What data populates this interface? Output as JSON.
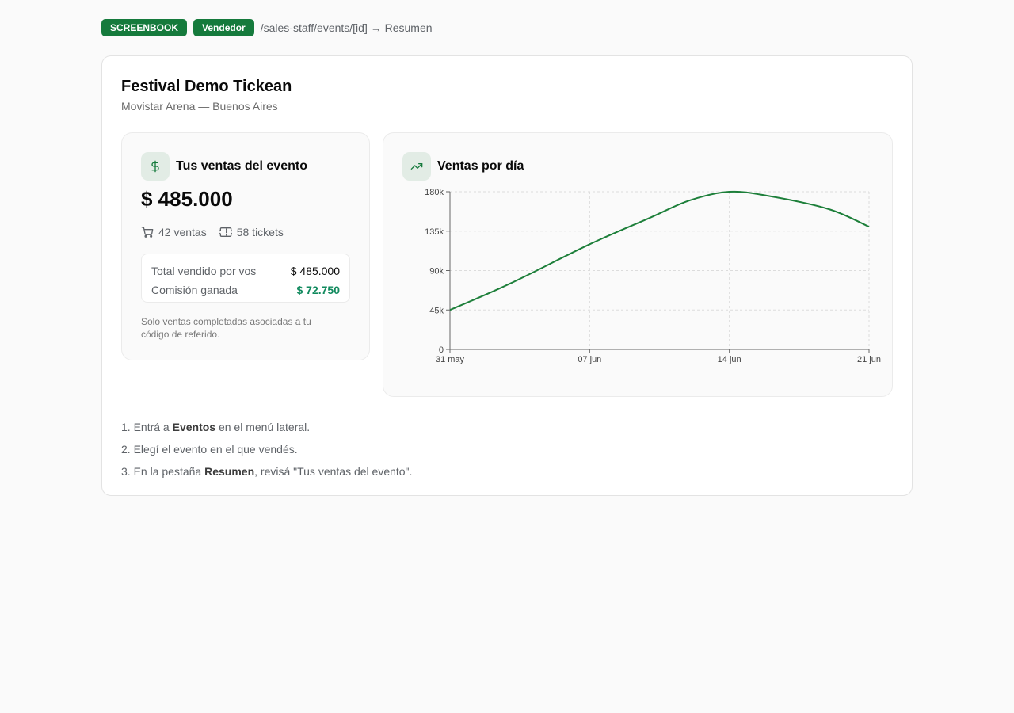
{
  "header": {
    "badge_screenbook": "SCREENBOOK",
    "badge_role": "Vendedor",
    "route": "/sales-staff/events/[id] → Resumen"
  },
  "event": {
    "title": "Festival Demo Tickean",
    "venue": "Movistar Arena — Buenos Aires"
  },
  "sales_panel": {
    "icon": "dollar-icon",
    "title": "Tus ventas del evento",
    "amount": "$ 485.000",
    "sales_count": "42 ventas",
    "tickets_count": "58 tickets",
    "total_label": "Total vendido por vos",
    "total_value": "$ 485.000",
    "commission_label": "Comisión ganada",
    "commission_value": "$ 72.750",
    "note": "Solo ventas completadas asociadas a tu código de referido."
  },
  "chart_panel": {
    "icon": "trending-up-icon",
    "title": "Ventas por día"
  },
  "chart_data": {
    "type": "line",
    "title": "",
    "xlabel": "",
    "ylabel": "",
    "x_ticks": [
      "31 may",
      "07 jun",
      "14 jun",
      "21 jun"
    ],
    "y_ticks": [
      "0",
      "45k",
      "90k",
      "135k",
      "180k"
    ],
    "ylim": [
      0,
      180000
    ],
    "series": [
      {
        "color": "#1d7f3a",
        "x": [
          "31 may",
          "03 jun",
          "07 jun",
          "10 jun",
          "12 jun",
          "14 jun",
          "16 jun",
          "19 jun",
          "21 jun"
        ],
        "y": [
          45000,
          75000,
          120000,
          150000,
          170000,
          180000,
          175000,
          160000,
          140000
        ]
      }
    ],
    "grid": true
  },
  "steps": {
    "s1_a": "Entrá a ",
    "s1_b": "Eventos",
    "s1_c": " en el menú lateral.",
    "s2": "Elegí el evento en el que vendés.",
    "s3_a": "En la pestaña ",
    "s3_b": "Resumen",
    "s3_c": ", revisá \"Tus ventas del evento\"."
  },
  "colors": {
    "brand_green": "#157a3c",
    "commission_green": "#118a5e"
  }
}
